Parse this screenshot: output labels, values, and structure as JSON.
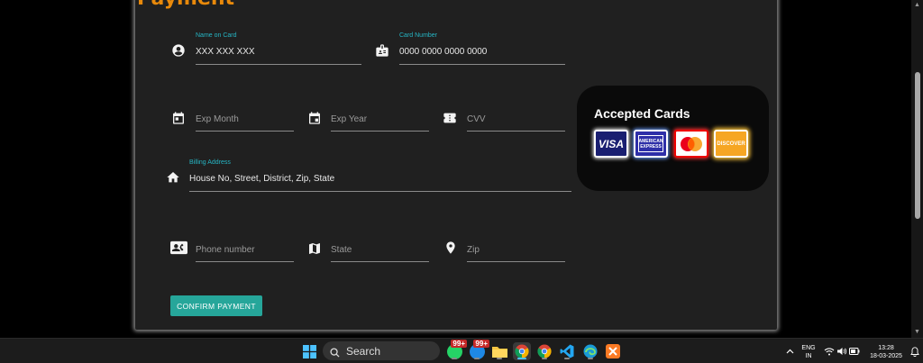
{
  "form": {
    "title": "Payment",
    "name_on_card": {
      "label": "Name on Card",
      "value": "XXX XXX XXX"
    },
    "card_number": {
      "label": "Card Number",
      "value": "0000 0000 0000 0000"
    },
    "exp_month": {
      "placeholder": "Exp Month"
    },
    "exp_year": {
      "placeholder": "Exp Year"
    },
    "cvv": {
      "placeholder": "CVV"
    },
    "billing_address": {
      "label": "Billing Address",
      "value": "House No, Street, District, Zip, State"
    },
    "phone": {
      "placeholder": "Phone number"
    },
    "state": {
      "placeholder": "State"
    },
    "zip": {
      "placeholder": "Zip"
    },
    "confirm_label": "CONFIRM PAYMENT"
  },
  "accepted_cards": {
    "title": "Accepted Cards",
    "cards": [
      {
        "name": "visa",
        "text": "VISA"
      },
      {
        "name": "amex",
        "text": "AMERICAN EXPRESS"
      },
      {
        "name": "mastercard",
        "text": ""
      },
      {
        "name": "discover",
        "text": "DISCOVER"
      }
    ]
  },
  "taskbar": {
    "search_label": "Search",
    "badge_1": "99+",
    "badge_2": "99+",
    "lang_line1": "ENG",
    "lang_line2": "IN",
    "time": "13:28",
    "date": "18-03-2025"
  },
  "colors": {
    "accent": "#26a69a",
    "title": "#e8890b",
    "label": "#26b6c5"
  }
}
